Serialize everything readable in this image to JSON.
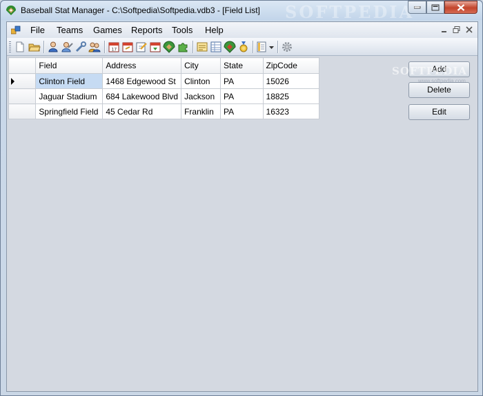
{
  "window": {
    "title": "Baseball Stat Manager - C:\\Softpedia\\Softpedia.vdb3 - [Field List]",
    "watermark": "SOFTPEDIA"
  },
  "menubar": {
    "items": [
      {
        "label": "File"
      },
      {
        "label": "Teams"
      },
      {
        "label": "Games"
      },
      {
        "label": "Reports"
      },
      {
        "label": "Tools"
      },
      {
        "label": "Help"
      }
    ]
  },
  "toolbar": {
    "icons": [
      "new-document-icon",
      "open-folder-icon",
      "player-icon",
      "coach-icon",
      "tools-icon",
      "team-icon",
      "calendar-icon",
      "schedule-icon",
      "edit-game-icon",
      "game-results-icon",
      "baseball-field-icon",
      "puzzle-icon",
      "report-icon",
      "table-icon",
      "field-icon",
      "award-icon",
      "layout-dropdown-icon",
      "settings-icon"
    ]
  },
  "grid": {
    "columns": [
      "Field",
      "Address",
      "City",
      "State",
      "ZipCode"
    ],
    "rows": [
      {
        "field": "Clinton Field",
        "address": "1468 Edgewood St",
        "city": "Clinton",
        "state": "PA",
        "zip": "15026"
      },
      {
        "field": "Jaguar Stadium",
        "address": "684 Lakewood Blvd",
        "city": "Jackson",
        "state": "PA",
        "zip": "18825"
      },
      {
        "field": "Springfield Field",
        "address": "45 Cedar Rd",
        "city": "Franklin",
        "state": "PA",
        "zip": "16323"
      }
    ]
  },
  "actions": {
    "add": "Add",
    "delete": "Delete",
    "edit": "Edit"
  },
  "watermarks": {
    "buttons": "SOFTPEDIA",
    "url": "www.softpedia.com"
  }
}
